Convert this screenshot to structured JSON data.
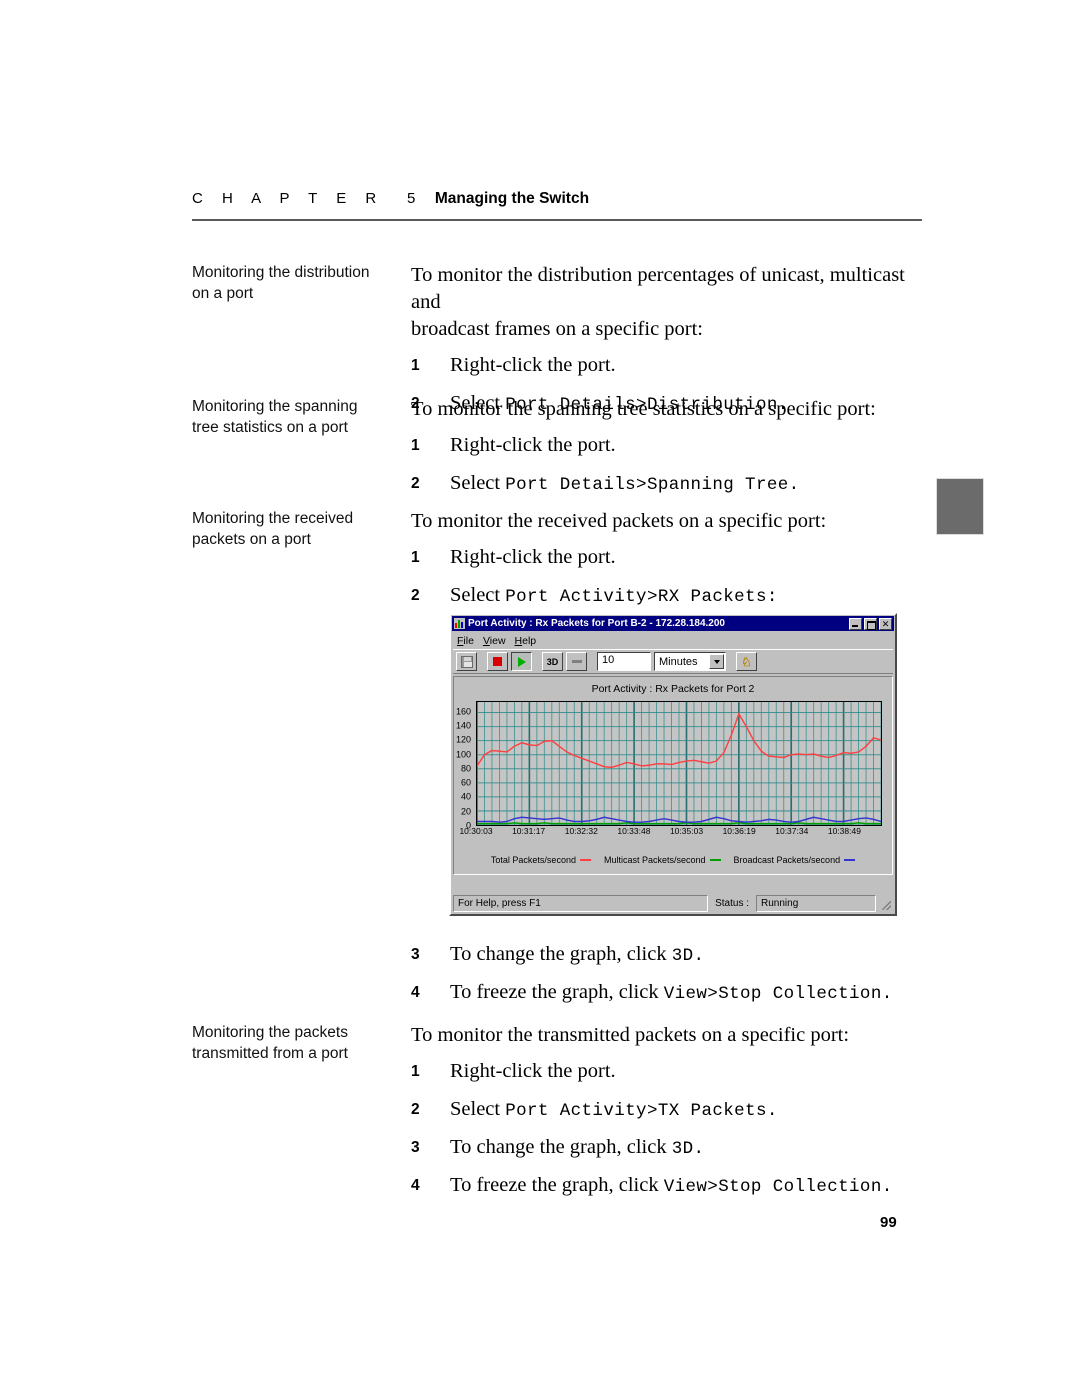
{
  "header": {
    "chapter_word": "C H A P T E R  5",
    "chapter_title": "Managing the Switch"
  },
  "page_number": "99",
  "sections": [
    {
      "side_line1": "Monitoring the distribution",
      "side_line2": "on a port",
      "lead_line1": "To monitor the distribution percentages of unicast, multicast and",
      "lead_line2": "broadcast frames on a specific port:",
      "steps": [
        {
          "num": "1",
          "text": "Right-click the port.",
          "mono": ""
        },
        {
          "num": "2",
          "text": "Select ",
          "mono": "Port Details>Distribution."
        }
      ]
    },
    {
      "side_line1": "Monitoring the spanning",
      "side_line2": "tree statistics on a port",
      "lead_line1": "To monitor the spanning tree statistics on a specific port:",
      "lead_line2": "",
      "steps": [
        {
          "num": "1",
          "text": "Right-click the port.",
          "mono": ""
        },
        {
          "num": "2",
          "text": "Select ",
          "mono": "Port Details>Spanning Tree."
        }
      ]
    },
    {
      "side_line1": "Monitoring the received",
      "side_line2": "packets on a port",
      "lead_line1": "To monitor the received packets on a specific port:",
      "lead_line2": "",
      "steps": [
        {
          "num": "1",
          "text": "Right-click the port.",
          "mono": ""
        },
        {
          "num": "2",
          "text": "Select ",
          "mono": "Port Activity>RX Packets:"
        }
      ]
    },
    {
      "side_line1": "",
      "side_line2": "",
      "lead_line1": "",
      "lead_line2": "",
      "steps": [
        {
          "num": "3",
          "text": "To change the graph, click ",
          "mono": "3D."
        },
        {
          "num": "4",
          "text": "To freeze the graph, click ",
          "mono": "View>Stop Collection."
        }
      ]
    },
    {
      "side_line1": "Monitoring the packets",
      "side_line2": "transmitted from a port",
      "lead_line1": "To monitor the transmitted packets on a specific port:",
      "lead_line2": "",
      "steps": [
        {
          "num": "1",
          "text": "Right-click the port.",
          "mono": ""
        },
        {
          "num": "2",
          "text": "Select ",
          "mono": "Port Activity>TX Packets."
        },
        {
          "num": "3",
          "text": "To change the graph, click ",
          "mono": "3D."
        },
        {
          "num": "4",
          "text": "To freeze the graph, click ",
          "mono": "View>Stop Collection."
        }
      ]
    }
  ],
  "app": {
    "title": "Port Activity : Rx Packets for Port B-2 - 172.28.184.200",
    "menu": [
      {
        "label": "File",
        "accel": "F"
      },
      {
        "label": "View",
        "accel": "V"
      },
      {
        "label": "Help",
        "accel": "H"
      }
    ],
    "toolbar": {
      "save_label": "",
      "stop_label": "",
      "play_label": "",
      "threed_label": "3D",
      "flat_label": "",
      "interval_value": "10",
      "interval_unit": "Minutes",
      "help_label": "?"
    },
    "statusbar": {
      "hint": "For Help, press F1",
      "status_label": "Status :",
      "status_value": "Running"
    },
    "colors": {
      "title_bar": "#000080",
      "window_face": "#c0c0c0",
      "plot_bg": "#c5c5c5",
      "gridline": "#2e8b8b",
      "total": "#ff4040",
      "multicast": "#00a000",
      "broadcast": "#3434d0"
    }
  },
  "chart_data": {
    "type": "line",
    "title": "Port Activity : Rx Packets for Port  2",
    "xlabel": "",
    "ylabel": "",
    "ylim": [
      0,
      175
    ],
    "yticks": [
      0,
      20,
      40,
      60,
      80,
      100,
      120,
      140,
      160
    ],
    "grid": true,
    "legend_position": "bottom",
    "xtick_labels": [
      "10:30:03",
      "10:31:17",
      "10:32:32",
      "10:33:48",
      "10:35:03",
      "10:36:19",
      "10:37:34",
      "10:38:49"
    ],
    "xtick_positions": [
      0,
      7,
      14,
      21,
      28,
      35,
      42,
      49
    ],
    "x": [
      0,
      1,
      2,
      3,
      4,
      5,
      6,
      7,
      8,
      9,
      10,
      11,
      12,
      13,
      14,
      15,
      16,
      17,
      18,
      19,
      20,
      21,
      22,
      23,
      24,
      25,
      26,
      27,
      28,
      29,
      30,
      31,
      32,
      33,
      34,
      35,
      36,
      37,
      38,
      39,
      40,
      41,
      42,
      43,
      44,
      45,
      46,
      47,
      48,
      49,
      50,
      51,
      52,
      53,
      54
    ],
    "series": [
      {
        "name": "Total Packets/second",
        "color": "#ff4040",
        "values": [
          84,
          100,
          106,
          105,
          104,
          112,
          117,
          114,
          113,
          119,
          120,
          112,
          104,
          99,
          95,
          91,
          87,
          83,
          82,
          85,
          89,
          87,
          84,
          85,
          87,
          87,
          86,
          89,
          91,
          92,
          90,
          88,
          91,
          103,
          128,
          158,
          140,
          120,
          105,
          98,
          97,
          96,
          100,
          101,
          100,
          101,
          98,
          96,
          99,
          103,
          102,
          104,
          112,
          124,
          121
        ]
      },
      {
        "name": "Multicast Packets/second",
        "color": "#00a000",
        "values": [
          2,
          2,
          2,
          2,
          2,
          3,
          2,
          2,
          2,
          3,
          2,
          2,
          2,
          2,
          2,
          2,
          2,
          2,
          2,
          2,
          3,
          2,
          2,
          2,
          2,
          2,
          2,
          2,
          3,
          2,
          2,
          2,
          2,
          2,
          2,
          3,
          2,
          2,
          2,
          2,
          2,
          2,
          2,
          3,
          2,
          2,
          2,
          2,
          2,
          2,
          2,
          3,
          2,
          2,
          2
        ]
      },
      {
        "name": "Broadcast Packets/second",
        "color": "#3434d0",
        "values": [
          5,
          5,
          5,
          4,
          5,
          9,
          11,
          10,
          9,
          8,
          9,
          10,
          7,
          5,
          5,
          6,
          8,
          11,
          9,
          7,
          5,
          4,
          4,
          5,
          7,
          9,
          7,
          5,
          4,
          4,
          5,
          8,
          11,
          9,
          6,
          5,
          4,
          5,
          6,
          8,
          7,
          5,
          4,
          5,
          8,
          11,
          9,
          7,
          5,
          5,
          7,
          9,
          10,
          8,
          5
        ]
      }
    ]
  }
}
